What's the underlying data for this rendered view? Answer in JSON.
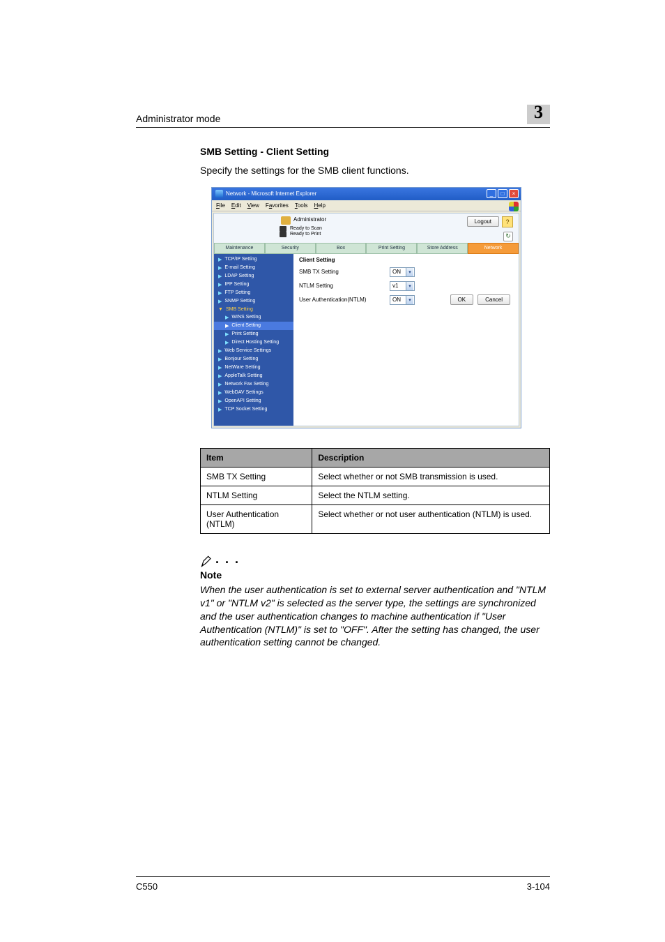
{
  "header": {
    "left": "Administrator mode",
    "chapter": "3"
  },
  "section": {
    "title": "SMB Setting - Client Setting",
    "intro": "Specify the settings for the SMB client functions."
  },
  "screenshot": {
    "window_title": "Network - Microsoft Internet Explorer",
    "menus": {
      "file": "File",
      "edit": "Edit",
      "view": "View",
      "favorites": "Favorites",
      "tools": "Tools",
      "help": "Help"
    },
    "admin_label": "Administrator",
    "status": {
      "scan": "Ready to Scan",
      "print": "Ready to Print"
    },
    "logout": "Logout",
    "help_icon": "?",
    "refresh_icon": "↻",
    "tabs": {
      "maintenance": "Maintenance",
      "security": "Security",
      "box": "Box",
      "print": "Print Setting",
      "store": "Store Address",
      "network": "Network"
    },
    "sidebar": {
      "tcpip": "TCP/IP Setting",
      "email": "E-mail Setting",
      "ldap": "LDAP Setting",
      "ipp": "IPP Setting",
      "ftp": "FTP Setting",
      "snmp": "SNMP Setting",
      "smb": "SMB Setting",
      "wins": "WINS Setting",
      "client": "Client Setting",
      "printsub": "Print Setting",
      "direct": "Direct Hosting Setting",
      "webservice": "Web Service Settings",
      "bonjour": "Bonjour Setting",
      "netware": "NetWare Setting",
      "appletalk": "AppleTalk Setting",
      "netfax": "Network Fax Setting",
      "webdav": "WebDAV Settings",
      "openapi": "OpenAPI Setting",
      "tcpsocket": "TCP Socket Setting"
    },
    "content": {
      "title": "Client Setting",
      "rows": {
        "smb_tx": {
          "label": "SMB TX Setting",
          "value": "ON"
        },
        "ntlm": {
          "label": "NTLM Setting",
          "value": "v1"
        },
        "userauth": {
          "label": "User Authentication(NTLM)",
          "value": "ON"
        }
      },
      "ok": "OK",
      "cancel": "Cancel"
    },
    "titlebtns": {
      "min": "_",
      "max": "□",
      "close": "×"
    }
  },
  "table": {
    "head": {
      "item": "Item",
      "desc": "Description"
    },
    "rows": [
      {
        "item": "SMB TX Setting",
        "desc": "Select whether or not SMB transmission is used."
      },
      {
        "item": "NTLM Setting",
        "desc": "Select the NTLM setting."
      },
      {
        "item": "User Authentication (NTLM)",
        "desc": "Select whether or not user authentication (NTLM) is used."
      }
    ]
  },
  "note": {
    "heading": "Note",
    "dots": ". . .",
    "text": "When the user authentication is set to external server authentication and \"NTLM v1\" or \"NTLM v2\" is selected as the server type, the settings are synchronized and the user authentication changes to machine authentication if \"User Authentication (NTLM)\" is set to \"OFF\". After the setting has changed, the user authentication setting cannot be changed."
  },
  "footer": {
    "left": "C550",
    "right": "3-104"
  }
}
